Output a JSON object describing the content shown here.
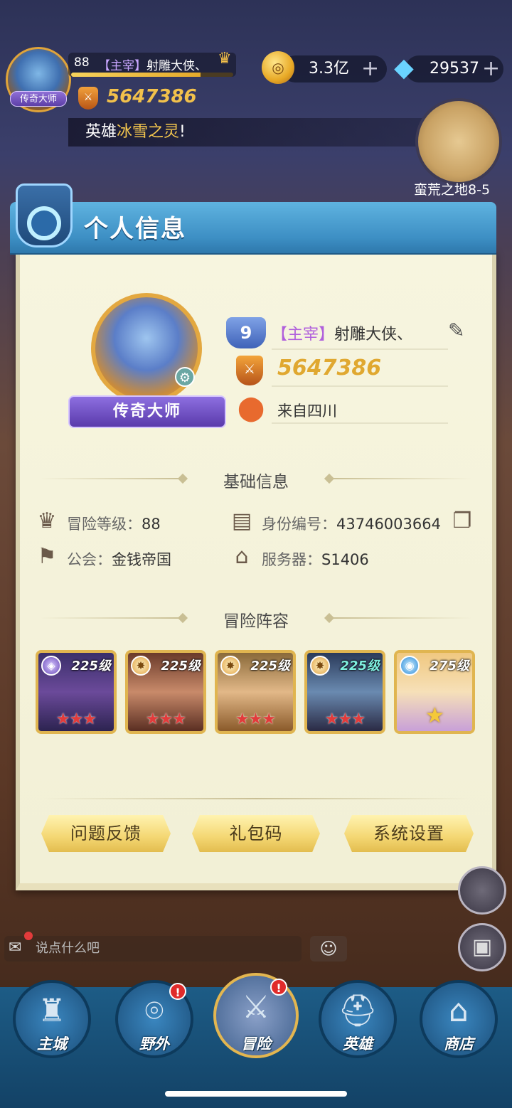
{
  "hud": {
    "avatar_tag": "传奇大师",
    "level": "88",
    "name_tag": "【主宰】",
    "name": "射雕大侠、",
    "exp_fraction": 0.8,
    "power": "5647386",
    "gold": "3.3亿",
    "gems": "29537",
    "ticker_prefix": "英雄",
    "ticker_highlight": "冰雪之灵",
    "ticker_suffix": "!",
    "map_label": "蛮荒之地8-5"
  },
  "panel": {
    "title": "个人信息",
    "profile": {
      "rank_title": "传奇大师",
      "vip_level": "9",
      "name_tag": "【主宰】",
      "name": "射雕大侠、",
      "power": "5647386",
      "location": "来自四川"
    },
    "basic": {
      "section_title": "基础信息",
      "adventure_level_label": "冒险等级：",
      "adventure_level": "88",
      "id_label": "身份编号：",
      "id_value": "43746003664",
      "guild_label": "公会：",
      "guild": "金钱帝国",
      "server_label": "服务器：",
      "server": "S1406"
    },
    "lineup": {
      "section_title": "冒险阵容",
      "heroes": [
        {
          "level": "225级",
          "stars": "★★★",
          "element": "purple-element-icon"
        },
        {
          "level": "225级",
          "stars": "★★★",
          "element": "sun-element-icon"
        },
        {
          "level": "225级",
          "stars": "★★★",
          "element": "sun-element-icon"
        },
        {
          "level": "225级",
          "stars": "★★★",
          "element": "sun-element-icon"
        },
        {
          "level": "275级",
          "stars": "★",
          "element": "water-element-icon"
        }
      ]
    },
    "buttons": {
      "feedback": "问题反馈",
      "gift_code": "礼包码",
      "settings": "系统设置"
    }
  },
  "chat": {
    "placeholder": "说点什么吧"
  },
  "nav": {
    "main_city": "主城",
    "wild": "野外",
    "adventure": "冒险",
    "heroes": "英雄",
    "shop": "商店",
    "alert": "!"
  }
}
